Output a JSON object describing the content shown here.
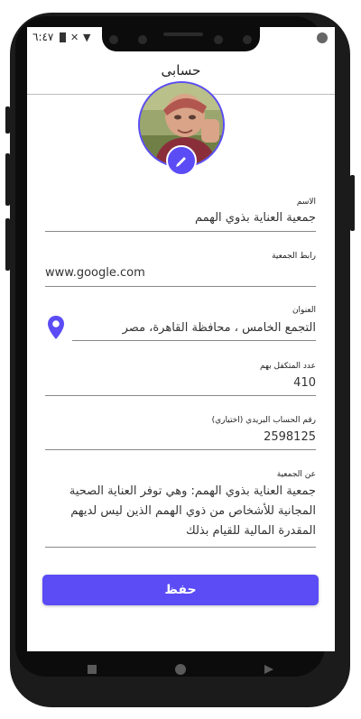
{
  "status_bar": {
    "time": "٦:٤٧"
  },
  "header": {
    "title": "حسابى"
  },
  "fields": {
    "name": {
      "label": "الاسم",
      "value": "جمعية العناية بذوي الهمم"
    },
    "link": {
      "label": "رابط الجمعية",
      "value": "www.google.com"
    },
    "address": {
      "label": "العنوان",
      "value": "التجمع الخامس ، محافظة القاهرة، مصر"
    },
    "count": {
      "label": "عدد المتكفل بهم",
      "value": "410"
    },
    "mail": {
      "label": "رقم الحساب البريدي (اختياري)",
      "value": "2598125"
    },
    "about": {
      "label": "عن الجمعية",
      "value": "جمعية العناية بذوي الهمم: وهي توفر العناية الصحية المجانية للأشخاص من ذوي الهمم الذين ليس لديهم المقدرة المالية للقيام بذلك"
    }
  },
  "actions": {
    "save_label": "حفظ"
  },
  "icons": {
    "edit": "pencil-icon",
    "location": "location-pin-icon",
    "back": "nav-back-icon",
    "home": "nav-home-icon",
    "recents": "nav-recents-icon"
  },
  "colors": {
    "accent": "#5b4cf5",
    "frame": "#1b1b1b",
    "text": "#333333"
  }
}
